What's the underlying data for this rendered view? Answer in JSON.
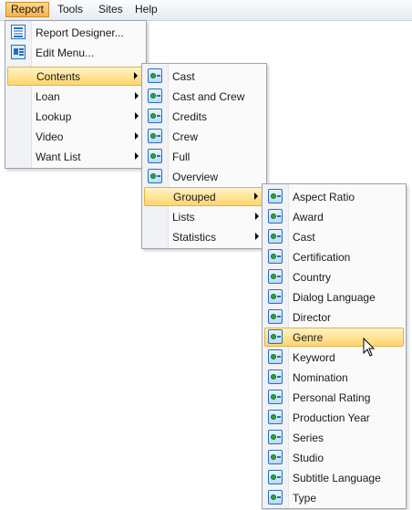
{
  "menubar": {
    "items": [
      {
        "label": "Report",
        "active": true
      },
      {
        "label": "Tools"
      },
      {
        "label": "Sites"
      },
      {
        "label": "Help"
      }
    ]
  },
  "report_menu": {
    "items": [
      {
        "label": "Report Designer...",
        "icon": "report-designer-icon"
      },
      {
        "label": "Edit Menu...",
        "icon": "edit-menu-icon"
      },
      {
        "label": "Contents",
        "submenu": true,
        "highlighted": true
      },
      {
        "label": "Loan",
        "submenu": true
      },
      {
        "label": "Lookup",
        "submenu": true
      },
      {
        "label": "Video",
        "submenu": true
      },
      {
        "label": "Want List",
        "submenu": true
      }
    ]
  },
  "contents_menu": {
    "items": [
      {
        "label": "Cast",
        "icon": "report-icon"
      },
      {
        "label": "Cast and Crew",
        "icon": "report-icon"
      },
      {
        "label": "Credits",
        "icon": "report-icon"
      },
      {
        "label": "Crew",
        "icon": "report-icon"
      },
      {
        "label": "Full",
        "icon": "report-icon"
      },
      {
        "label": "Overview",
        "icon": "report-icon"
      },
      {
        "label": "Grouped",
        "submenu": true,
        "highlighted": true
      },
      {
        "label": "Lists",
        "submenu": true
      },
      {
        "label": "Statistics",
        "submenu": true
      }
    ]
  },
  "grouped_menu": {
    "items": [
      {
        "label": "Aspect Ratio",
        "icon": "report-icon"
      },
      {
        "label": "Award",
        "icon": "report-icon"
      },
      {
        "label": "Cast",
        "icon": "report-icon"
      },
      {
        "label": "Certification",
        "icon": "report-icon"
      },
      {
        "label": "Country",
        "icon": "report-icon"
      },
      {
        "label": "Dialog Language",
        "icon": "report-icon"
      },
      {
        "label": "Director",
        "icon": "report-icon"
      },
      {
        "label": "Genre",
        "icon": "report-icon",
        "highlighted": true
      },
      {
        "label": "Keyword",
        "icon": "report-icon"
      },
      {
        "label": "Nomination",
        "icon": "report-icon"
      },
      {
        "label": "Personal Rating",
        "icon": "report-icon"
      },
      {
        "label": "Production Year",
        "icon": "report-icon"
      },
      {
        "label": "Series",
        "icon": "report-icon"
      },
      {
        "label": "Studio",
        "icon": "report-icon"
      },
      {
        "label": "Subtitle Language",
        "icon": "report-icon"
      },
      {
        "label": "Type",
        "icon": "report-icon"
      }
    ]
  },
  "colors": {
    "highlight_top": "#fff3c8",
    "highlight_bottom": "#ffd56b",
    "menu_border": "#9ea4ab"
  }
}
